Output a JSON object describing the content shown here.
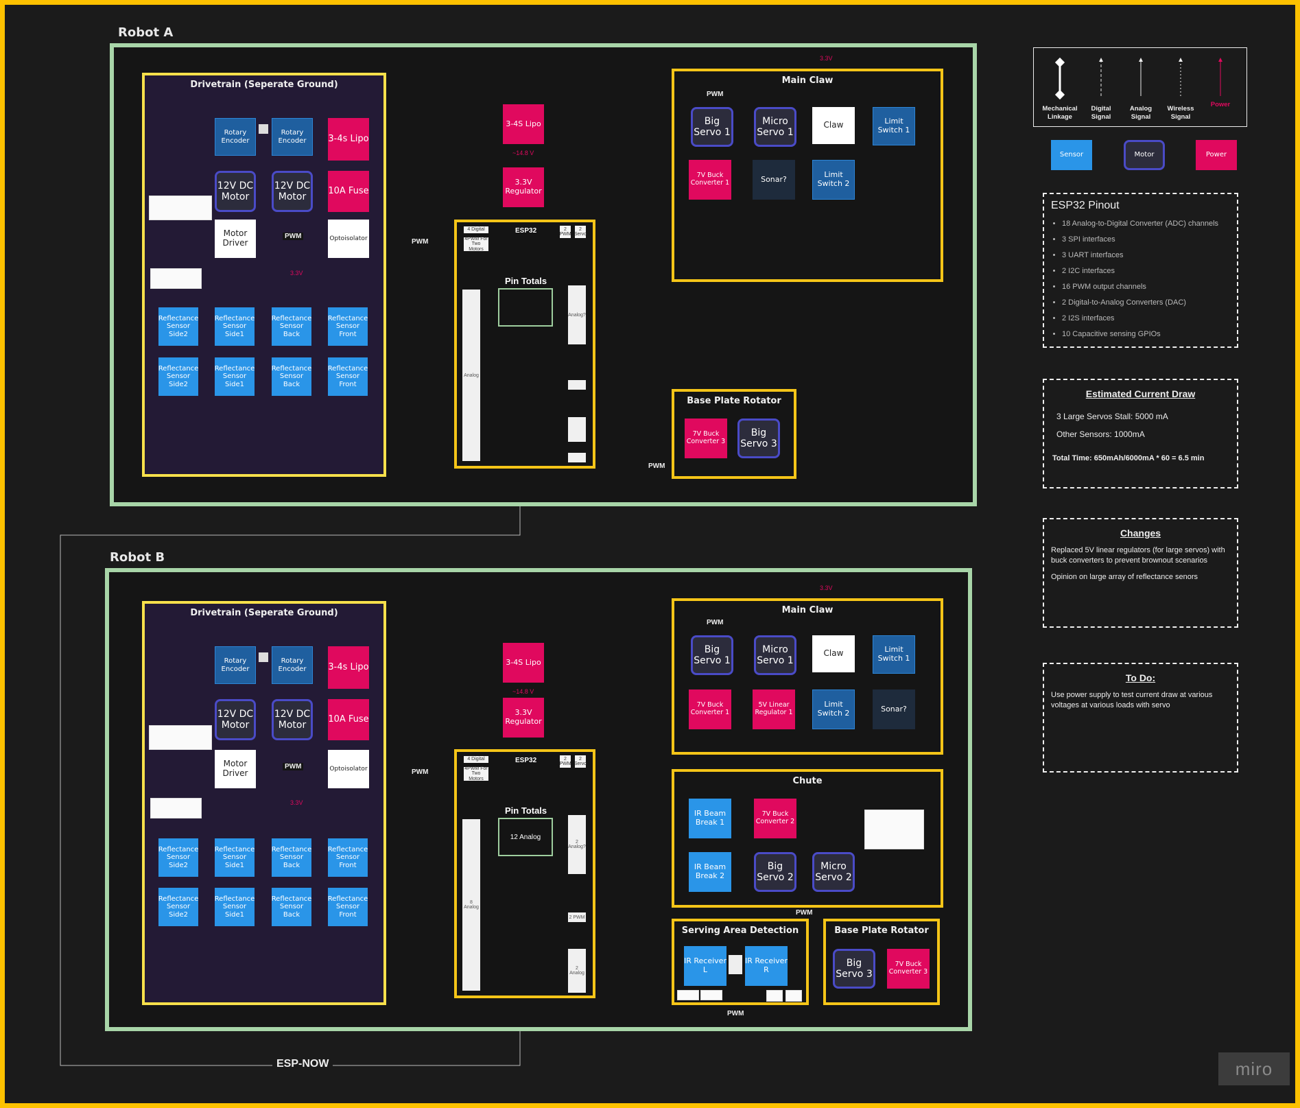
{
  "colors": {
    "sensor": "#2a95e8",
    "motor_border": "#4a4bc7",
    "power": "#e0095e",
    "frame_green": "#a8d5a8",
    "frame_yellow": "#f5c518",
    "background": "#1b1b1b"
  },
  "legend": {
    "items": [
      "Mechanical Linkage",
      "Digital Signal",
      "Analog Signal",
      "Wireless Signal",
      "Power"
    ],
    "keys": [
      "Sensor",
      "Motor",
      "Power"
    ]
  },
  "esp32_pinout": {
    "title": "ESP32 Pinout",
    "items": [
      "18 Analog-to-Digital Converter (ADC) channels",
      "3 SPI interfaces",
      "3 UART interfaces",
      "2 I2C interfaces",
      "16 PWM output channels",
      "2 Digital-to-Analog Converters (DAC)",
      "2 I2S interfaces",
      "10 Capacitive sensing GPIOs"
    ]
  },
  "current_draw": {
    "title": "Estimated Current Draw",
    "line1": "3 Large Servos Stall: 5000 mA",
    "line2": "Other Sensors: 1000mA",
    "total": "Total Time: 650mAh/6000mA * 60 = 6.5 min"
  },
  "changes": {
    "title": "Changes",
    "line1": "Replaced 5V linear regulators (for large servos) with buck converters to prevent brownout scenarios",
    "line2": "Opinion on large array of reflectance senors"
  },
  "todo": {
    "title": "To Do:",
    "line1": "Use power supply to test current draw at various voltages at various loads with servo"
  },
  "common": {
    "drivetrain_title": "Drivetrain (Seperate Ground)",
    "rotary_encoder": "Rotary Encoder",
    "dc_motor": "12V DC Motor",
    "lipo_small": "3-4s Lipo",
    "fuse": "10A Fuse",
    "motor_driver": "Motor Driver",
    "optoisolator": "Optoisolator",
    "pwm": "PWM",
    "v33": "3.3V",
    "v148": "~14.8 V",
    "refl_side2": "Reflectance Sensor Side2",
    "refl_side1": "Reflectance Sensor Side1",
    "refl_back": "Reflectance Sensor Back",
    "refl_front": "Reflectance Sensor Front",
    "lipo_main": "3-4S Lipo",
    "regulator": "3.3V Regulator",
    "esp32": "ESP32",
    "four_digital": "4 Digital",
    "four_pwm": "4PWM For Two Motors",
    "two_pwm": "2 PWM",
    "two_servo": "2 Servo",
    "pin_totals": "Pin Totals",
    "main_claw": "Main Claw",
    "big_servo_1": "Big Servo 1",
    "micro_servo_1": "Micro Servo 1",
    "claw": "Claw",
    "limit_switch_1": "Limit Switch 1",
    "limit_switch_2": "Limit Switch 2",
    "buck_1": "7V Buck Converter 1",
    "buck_3": "7V Buck Converter 3",
    "base_plate": "Base Plate Rotator",
    "big_servo_3": "Big Servo 3"
  },
  "robot_a": {
    "title": "Robot A",
    "sonar": "Sonar?",
    "analog_bar": "Analog",
    "analog_q": "Analog?"
  },
  "robot_b": {
    "title": "Robot B",
    "sonar": "Sonar?",
    "linear_reg": "5V Linear Regulator 1",
    "pin_analog_box": "12 Analog",
    "analog_bar": "8 Analog",
    "analog_q": "2 Analog?",
    "two_pwm_bar": "2 PWM",
    "two_analog": "2 Analog",
    "chute": "Chute",
    "ir_break_1": "IR Beam Break 1",
    "ir_break_2": "IR Beam Break 2",
    "buck_2": "7V Buck Converter 2",
    "big_servo_2": "Big Servo 2",
    "micro_servo_2": "Micro Servo 2",
    "serving": "Serving Area Detection",
    "ir_recv_l": "IR Receiver L",
    "ir_recv_r": "IR Receiver R"
  },
  "esp_now": "ESP-NOW",
  "watermark": "miro"
}
